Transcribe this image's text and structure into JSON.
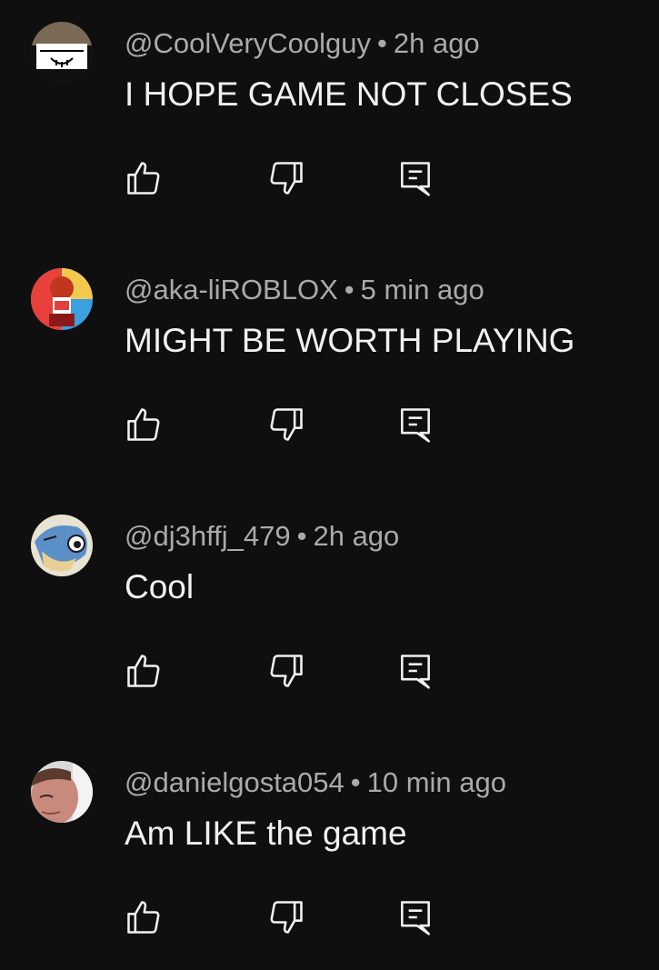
{
  "comments": [
    {
      "author": "@CoolVeryCoolguy",
      "time": "2h ago",
      "text": "I HOPE GAME NOT CLOSES",
      "avatar_icon": "drawn-face-avatar"
    },
    {
      "author": "@aka-liROBLOX",
      "time": "5 min ago",
      "text": "MIGHT BE WORTH PLAYING",
      "avatar_icon": "roblox-character-avatar"
    },
    {
      "author": "@dj3hffj_479",
      "time": "2h ago",
      "text": "Cool",
      "avatar_icon": "cartoon-dog-avatar"
    },
    {
      "author": "@danielgosta054",
      "time": "10 min ago",
      "text": "Am LIKE the game",
      "avatar_icon": "photo-face-avatar"
    }
  ],
  "separator": "•",
  "icons": {
    "like": "thumbs-up-icon",
    "dislike": "thumbs-down-icon",
    "reply": "reply-icon"
  },
  "colors": {
    "background": "#0f0f0f",
    "text": "#f1f1f1",
    "meta": "#aaaaaa"
  }
}
